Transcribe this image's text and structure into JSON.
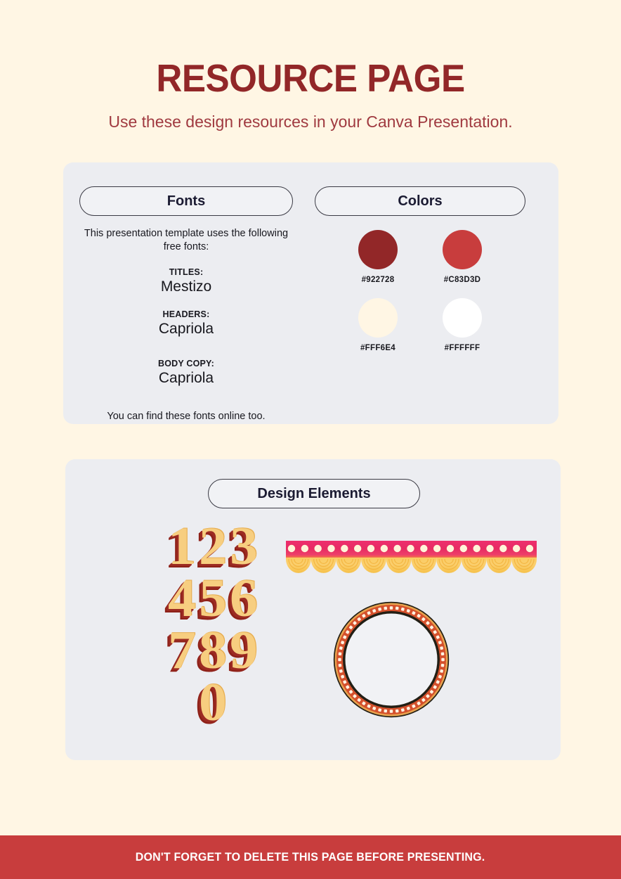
{
  "header": {
    "title": "RESOURCE PAGE",
    "subtitle": "Use these design resources in your Canva Presentation."
  },
  "fonts_panel": {
    "label": "Fonts",
    "intro": "This presentation template uses the following free fonts:",
    "groups": [
      {
        "role": "TITLES:",
        "name": "Mestizo"
      },
      {
        "role": "HEADERS:",
        "name": "Capriola"
      },
      {
        "role": "BODY COPY:",
        "name": "Capriola"
      }
    ],
    "outro": "You can find these fonts online too."
  },
  "colors_panel": {
    "label": "Colors",
    "swatches": [
      {
        "hex": "#922728",
        "value": "#922728"
      },
      {
        "hex": "#C83D3D",
        "value": "#C83D3D"
      },
      {
        "hex": "#FFF6E4",
        "value": "#FFF6E4"
      },
      {
        "hex": "#FFFFFF",
        "value": "#FFFFFF"
      }
    ]
  },
  "design_panel": {
    "label": "Design Elements",
    "numbers": [
      [
        "1",
        "2",
        "3"
      ],
      [
        "4",
        "5",
        "6"
      ],
      [
        "7",
        "8",
        "9"
      ],
      [
        "0"
      ]
    ],
    "graphics": [
      {
        "name": "marquee-scallop-banner"
      },
      {
        "name": "beaded-circle-frame"
      }
    ]
  },
  "footer": {
    "text": "DON'T FORGET TO DELETE THIS PAGE BEFORE PRESENTING."
  },
  "theme": {
    "background": "#FFF6E4",
    "panel": "#ECEDF1",
    "accent_dark_red": "#922728",
    "accent_red": "#C83D3D",
    "ink": "#1B1B32",
    "gold": "#F7CE80",
    "pink": "#E8306A"
  }
}
